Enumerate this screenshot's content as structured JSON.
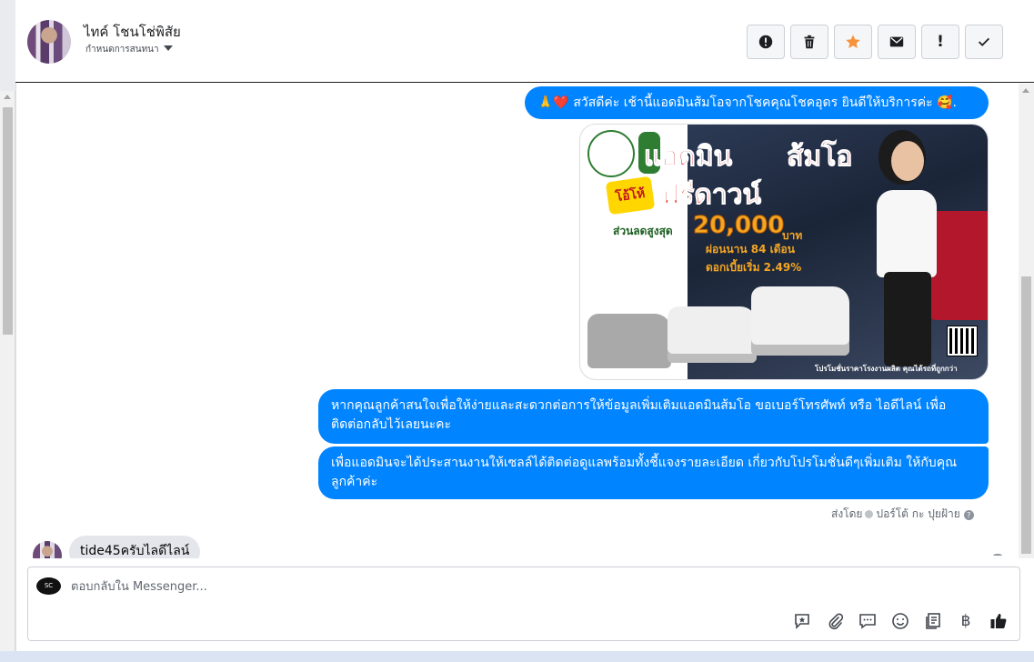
{
  "header": {
    "contact_name": "ไทค์ โชนโช่พิสัย",
    "assign_label": "กำหนดการสนทนา",
    "actions": [
      {
        "icon": "alert-circle-icon",
        "name": "mark-spam-button"
      },
      {
        "icon": "trash-icon",
        "name": "delete-button"
      },
      {
        "icon": "star-icon",
        "name": "star-button"
      },
      {
        "icon": "envelope-icon",
        "name": "mark-unread-button"
      },
      {
        "icon": "exclamation-icon",
        "name": "follow-up-button",
        "glyph": "!"
      },
      {
        "icon": "check-icon",
        "name": "mark-done-button"
      }
    ]
  },
  "messages": {
    "greeting": {
      "prefix_emoji": "🙏❤️",
      "text": "สวัสดีค่ะ เช้านี้แอดมินส้มโอจากโชคคุณโชคอุดร ยินดีให้บริการค่ะ",
      "suffix_emoji": "🥰."
    },
    "promo_image": {
      "headline_a": "แอดมิน",
      "headline_b": "ส้มโอ",
      "badge": "โอ้โห้",
      "headline_c": "ฟรีดาวน์",
      "discount_label": "ส่วนลดสูงสุด",
      "discount_value": "20,000",
      "discount_unit": "บาท",
      "installments": "ผ่อนนาน 84 เดือน",
      "interest": "ดอกเบี้ยเริ่ม 2.49%",
      "footer": "โปรโมชั่นราคาโรงงานผลิต คุณได้รถที่ถูกกว่า"
    },
    "outgoing_2": "หากคุณลูกค้าสนใจเพื่อให้ง่ายและสะดวกต่อการให้ข้อมูลเพิ่มเติมแอดมินส้มโอ ขอเบอร์โทรศัพท์ หรือ ไอดีไลน์ เพื่อติดต่อกลับไว้เลยนะคะ",
    "outgoing_3": "เพื่อแอดมินจะได้ประสานงานให้เซลล์ได้ติดต่อดูแลพร้อมทั้งชี้แจงรายละเอียด เกี่ยวกับโปรโมชั่นดีๆเพิ่มเติม ให้กับคุณลูกค้าค่ะ",
    "sent_by_label": "ส่งโดย",
    "sent_by_name": "ปอร์โต้ กะ ปุยฝ้าย",
    "incoming_1": "tide45ครับไลดีไลน์"
  },
  "composer": {
    "placeholder": "ตอบกลับใน Messenger...",
    "value": "",
    "page_avatar_text": "SC",
    "tools": [
      {
        "icon": "saved-reply-icon",
        "name": "saved-replies-button"
      },
      {
        "icon": "paperclip-icon",
        "name": "attach-button"
      },
      {
        "icon": "chat-bubble-icon",
        "name": "quick-reply-button"
      },
      {
        "icon": "smiley-icon",
        "name": "emoji-button"
      },
      {
        "icon": "catalog-icon",
        "name": "catalog-button"
      },
      {
        "icon": "baht-icon",
        "name": "payment-button",
        "glyph": "฿"
      },
      {
        "icon": "thumbs-up-icon",
        "name": "like-button"
      }
    ]
  },
  "colors": {
    "outgoing_bubble": "#0084ff",
    "incoming_bubble": "#e4e6eb",
    "star": "#f7923b"
  }
}
